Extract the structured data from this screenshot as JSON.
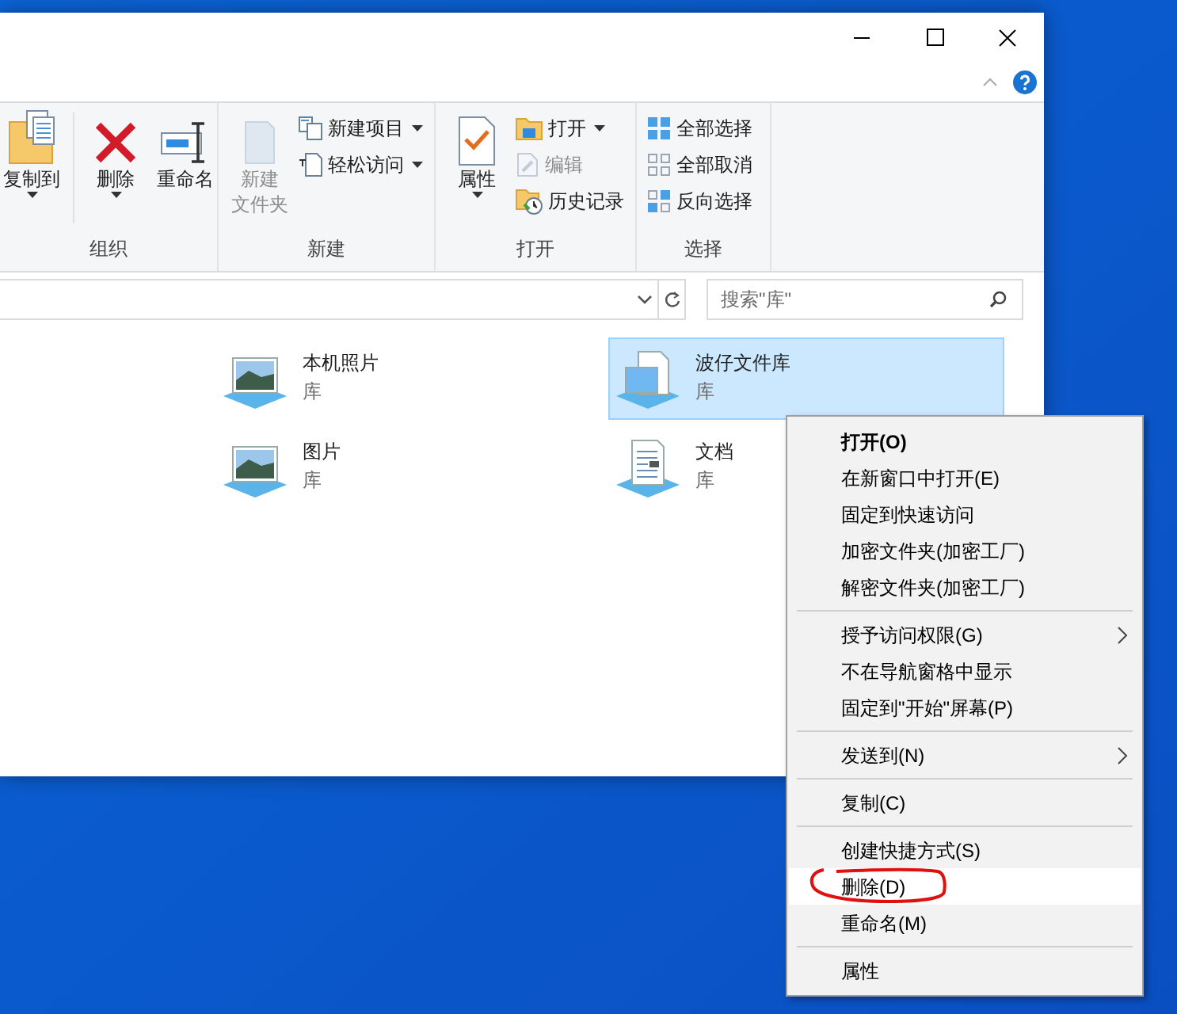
{
  "ribbon": {
    "groups": [
      {
        "label": "组织",
        "items": [
          {
            "kind": "large",
            "lines": [
              "复制到"
            ],
            "dropdown": true,
            "disabled": false
          },
          {
            "kind": "divider"
          },
          {
            "kind": "large",
            "lines": [
              "删除"
            ],
            "dropdown": true,
            "disabled": false
          },
          {
            "kind": "large",
            "lines": [
              "重命名"
            ],
            "dropdown": false,
            "disabled": false
          }
        ]
      },
      {
        "label": "新建",
        "items": [
          {
            "kind": "large",
            "lines": [
              "新建",
              "文件夹"
            ],
            "dropdown": false,
            "disabled": true
          },
          {
            "kind": "small",
            "label": "新建项目",
            "dropdown": true,
            "disabled": false
          },
          {
            "kind": "small",
            "label": "轻松访问",
            "dropdown": true,
            "disabled": false
          }
        ]
      },
      {
        "label": "打开",
        "items": [
          {
            "kind": "large",
            "lines": [
              "属性"
            ],
            "dropdown": true,
            "disabled": false
          },
          {
            "kind": "small",
            "label": "打开",
            "dropdown": true,
            "disabled": false
          },
          {
            "kind": "small",
            "label": "编辑",
            "dropdown": false,
            "disabled": true
          },
          {
            "kind": "small",
            "label": "历史记录",
            "dropdown": false,
            "disabled": false
          }
        ]
      },
      {
        "label": "选择",
        "items": [
          {
            "kind": "small",
            "label": "全部选择",
            "dropdown": false,
            "disabled": false
          },
          {
            "kind": "small",
            "label": "全部取消",
            "dropdown": false,
            "disabled": false
          },
          {
            "kind": "small",
            "label": "反向选择",
            "dropdown": false,
            "disabled": false
          }
        ]
      }
    ]
  },
  "search": {
    "placeholder": "搜索\"库\""
  },
  "libraries": [
    {
      "name": "本机照片",
      "type": "库",
      "selected": false
    },
    {
      "name": "波仔文件库",
      "type": "库",
      "selected": true
    },
    {
      "name": "图片",
      "type": "库",
      "selected": false
    },
    {
      "name": "文档",
      "type": "库",
      "selected": false
    }
  ],
  "context_menu": {
    "items": [
      {
        "kind": "item",
        "label": "打开(O)",
        "bold": true,
        "submenu": false,
        "highlighted": false,
        "circled": false
      },
      {
        "kind": "item",
        "label": "在新窗口中打开(E)",
        "bold": false,
        "submenu": false,
        "highlighted": false,
        "circled": false
      },
      {
        "kind": "item",
        "label": "固定到快速访问",
        "bold": false,
        "submenu": false,
        "highlighted": false,
        "circled": false
      },
      {
        "kind": "item",
        "label": "加密文件夹(加密工厂)",
        "bold": false,
        "submenu": false,
        "highlighted": false,
        "circled": false
      },
      {
        "kind": "item",
        "label": "解密文件夹(加密工厂)",
        "bold": false,
        "submenu": false,
        "highlighted": false,
        "circled": false
      },
      {
        "kind": "separator"
      },
      {
        "kind": "item",
        "label": "授予访问权限(G)",
        "bold": false,
        "submenu": true,
        "highlighted": false,
        "circled": false
      },
      {
        "kind": "item",
        "label": "不在导航窗格中显示",
        "bold": false,
        "submenu": false,
        "highlighted": false,
        "circled": false
      },
      {
        "kind": "item",
        "label": "固定到\"开始\"屏幕(P)",
        "bold": false,
        "submenu": false,
        "highlighted": false,
        "circled": false
      },
      {
        "kind": "separator"
      },
      {
        "kind": "item",
        "label": "发送到(N)",
        "bold": false,
        "submenu": true,
        "highlighted": false,
        "circled": false
      },
      {
        "kind": "separator"
      },
      {
        "kind": "item",
        "label": "复制(C)",
        "bold": false,
        "submenu": false,
        "highlighted": false,
        "circled": false
      },
      {
        "kind": "separator"
      },
      {
        "kind": "item",
        "label": "创建快捷方式(S)",
        "bold": false,
        "submenu": false,
        "highlighted": false,
        "circled": false
      },
      {
        "kind": "item",
        "label": "删除(D)",
        "bold": false,
        "submenu": false,
        "highlighted": true,
        "circled": true
      },
      {
        "kind": "item",
        "label": "重命名(M)",
        "bold": false,
        "submenu": false,
        "highlighted": false,
        "circled": false
      },
      {
        "kind": "separator"
      },
      {
        "kind": "item",
        "label": "属性",
        "bold": false,
        "submenu": false,
        "highlighted": false,
        "circled": false
      }
    ]
  }
}
